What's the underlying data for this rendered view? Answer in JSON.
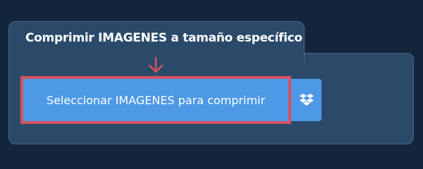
{
  "section": {
    "title": "Comprimir IMAGENES a tamaño específico"
  },
  "upload": {
    "button_label": "Seleccionar IMAGENES para comprimir",
    "dropbox_icon": "dropbox-icon"
  },
  "colors": {
    "page_bg": "#13253a",
    "panel_bg": "#2b4a6a",
    "button_bg": "#4d99e6",
    "highlight": "#d9525e"
  }
}
